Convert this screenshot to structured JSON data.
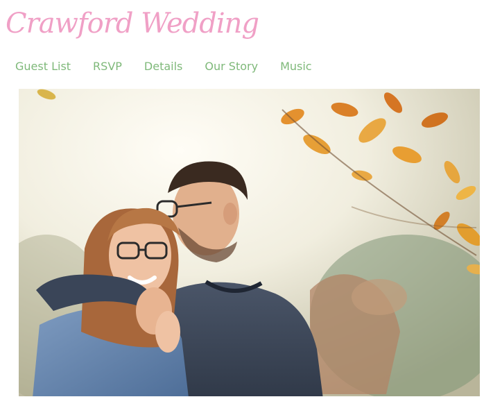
{
  "site": {
    "title": "Crawford Wedding"
  },
  "nav": {
    "items": [
      {
        "label": "Guest List"
      },
      {
        "label": "RSVP"
      },
      {
        "label": "Details"
      },
      {
        "label": "Our Story"
      },
      {
        "label": "Music"
      }
    ]
  },
  "hero": {
    "image": "engagement-photo"
  },
  "colors": {
    "title_pink": "#f0a0c6",
    "nav_green": "#7fb97a"
  }
}
